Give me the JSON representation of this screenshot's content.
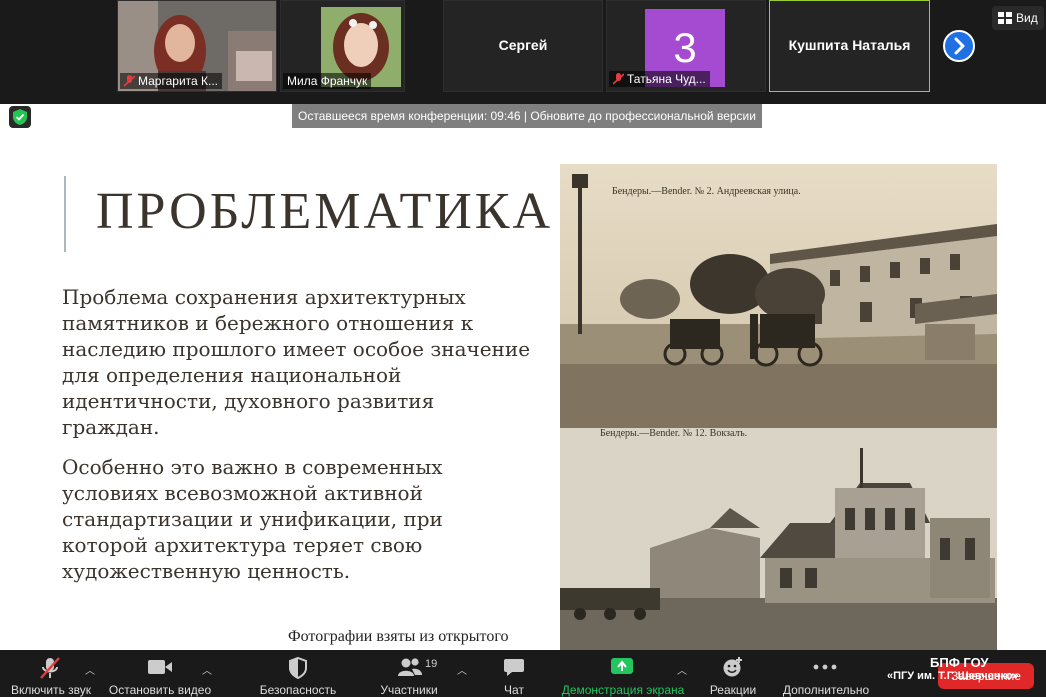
{
  "participants": [
    {
      "name": "Маргарита К..."
    },
    {
      "name": "Мила Франчук"
    },
    {
      "name": "Сергей"
    },
    {
      "name": "Татьяна Чуд...",
      "avatar_letter": "3"
    },
    {
      "name": "Кушпита Наталья"
    }
  ],
  "view_button": "Вид",
  "banner": {
    "text": "Оставшееся время конференции: 09:46 | Обновите до профессиональной версии"
  },
  "slide": {
    "title": "ПРОБЛЕМАТИКА",
    "para1": "Проблема сохранения архитектурных памятников и бережного отношения к наследию прошлого имеет особое значение для определения национальной идентичности, духовного развития граждан.",
    "para2": "Особенно это важно в современных условиях всевозможной активной стандартизации и унификации, при которой архитектура теряет свою художественную ценность.",
    "caption": "Фотографии взяты из открытого",
    "photo1_caption": "Бендеры.—Bender. № 2. Андреевская улица.",
    "photo2_caption": "Бендеры.—Bender. № 12. Вокзалъ."
  },
  "toolbar": {
    "mute": "Включить звук",
    "video": "Остановить видео",
    "security": "Безопасность",
    "participants": "Участники",
    "participants_count": "19",
    "chat": "Чат",
    "share": "Демонстрация экрана",
    "reactions": "Реакции",
    "more": "Дополнительно",
    "end": "Завершение"
  },
  "watermark": {
    "line1": "БПФ ГОУ",
    "line2": "«ПГУ им. Т.Г. Шевченко»"
  },
  "colors": {
    "share_green": "#22c55e",
    "end_red": "#e02828",
    "avatar_purple": "#a44bd1",
    "active_border": "#9acd32"
  }
}
